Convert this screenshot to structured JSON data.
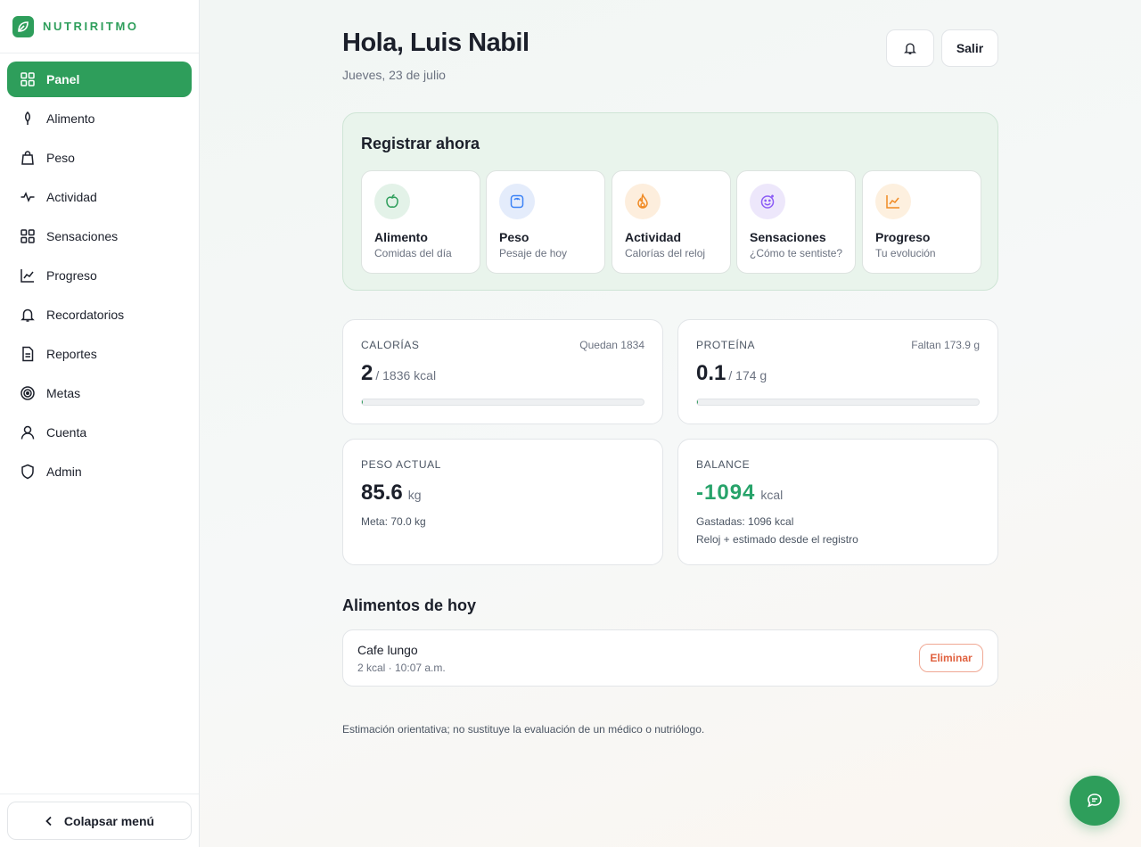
{
  "brand": {
    "name": "NUTRIRITMO"
  },
  "sidebar": {
    "items": [
      {
        "label": "Panel",
        "icon": "grid-icon",
        "active": true
      },
      {
        "label": "Alimento",
        "icon": "leaf-icon"
      },
      {
        "label": "Peso",
        "icon": "bag-icon"
      },
      {
        "label": "Actividad",
        "icon": "pulse-icon"
      },
      {
        "label": "Sensaciones",
        "icon": "grid-icon"
      },
      {
        "label": "Progreso",
        "icon": "chart-line-icon"
      },
      {
        "label": "Recordatorios",
        "icon": "bell-icon"
      },
      {
        "label": "Reportes",
        "icon": "document-icon"
      },
      {
        "label": "Metas",
        "icon": "target-icon"
      },
      {
        "label": "Cuenta",
        "icon": "user-icon"
      },
      {
        "label": "Admin",
        "icon": "shield-icon"
      }
    ],
    "collapse_label": "Colapsar menú"
  },
  "header": {
    "greeting": "Hola, Luis Nabil",
    "date": "Jueves, 23 de julio",
    "logout_label": "Salir"
  },
  "register": {
    "title": "Registrar ahora",
    "cards": [
      {
        "title": "Alimento",
        "subtitle": "Comidas del día",
        "icon": "apple-icon",
        "color": "#2e9e5b",
        "bg": "#e3f2e8"
      },
      {
        "title": "Peso",
        "subtitle": "Pesaje de hoy",
        "icon": "scale-icon",
        "color": "#3b82f6",
        "bg": "#e4ecfb"
      },
      {
        "title": "Actividad",
        "subtitle": "Calorías del reloj",
        "icon": "flame-icon",
        "color": "#f08a24",
        "bg": "#fdeedd"
      },
      {
        "title": "Sensaciones",
        "subtitle": "¿Cómo te sentiste?",
        "icon": "smile-icon",
        "color": "#8b5cf6",
        "bg": "#ede7fb"
      },
      {
        "title": "Progreso",
        "subtitle": "Tu evolución",
        "icon": "trend-icon",
        "color": "#f08a24",
        "bg": "#fdf0df"
      }
    ]
  },
  "stats": {
    "calories": {
      "label": "CALORÍAS",
      "right": "Quedan 1834",
      "value": "2",
      "unit": "/ 1836 kcal",
      "progress": 0.001
    },
    "protein": {
      "label": "PROTEÍNA",
      "right": "Faltan 173.9 g",
      "value": "0.1",
      "unit": "/ 174 g",
      "progress": 0.0006
    },
    "weight": {
      "label": "PESO ACTUAL",
      "value": "85.6",
      "unit": "kg",
      "note": "Meta: 70.0 kg"
    },
    "balance": {
      "label": "BALANCE",
      "value": "-1094",
      "unit": "kcal",
      "note1": "Gastadas: 1096 kcal",
      "note2": "Reloj + estimado desde el registro"
    }
  },
  "foods": {
    "title": "Alimentos de hoy",
    "items": [
      {
        "name": "Cafe lungo",
        "meta": "2 kcal · 10:07 a.m.",
        "delete_label": "Eliminar"
      }
    ]
  },
  "disclaimer": "Estimación orientativa; no sustituye la evaluación de un médico o nutriólogo.",
  "colors": {
    "accent": "#2e9e5b",
    "balance": "#27a36a",
    "danger": "#e0613f"
  }
}
